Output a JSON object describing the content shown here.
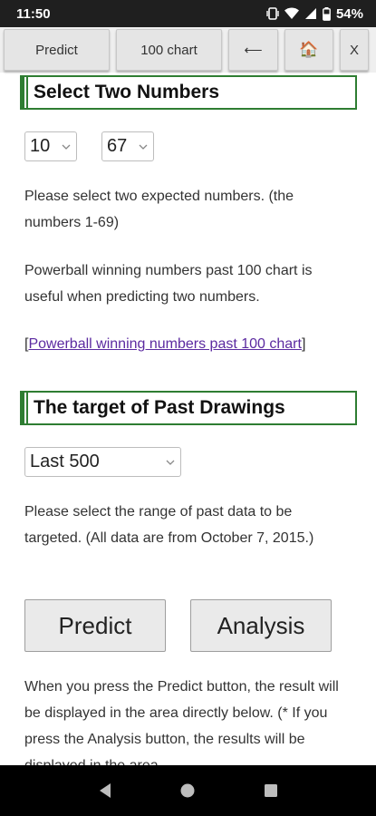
{
  "status_bar": {
    "time": "11:50",
    "battery": "54%"
  },
  "toolbar": {
    "predict_label": "Predict",
    "chart_label": "100 chart",
    "back_symbol": "⟵",
    "home_symbol": "🏠",
    "close_label": "X"
  },
  "select_numbers": {
    "heading": "Select Two Numbers",
    "first_value": "10",
    "second_value": "67",
    "help_text": "Please select two expected numbers. (the numbers 1-69)",
    "info_text": "Powerball winning numbers past 100 chart is useful when predicting two numbers.",
    "link_open": "[",
    "link_text": "Powerball winning numbers past 100 chart",
    "link_close": "]"
  },
  "past_drawings": {
    "heading": "The target of Past Drawings",
    "range_value": "Last 500",
    "help_text": "Please select the range of past data to be targeted. (All data are from October 7, 2015.)"
  },
  "actions": {
    "predict_label": "Predict",
    "analysis_label": "Analysis"
  },
  "footer_text": "When you press the Predict button, the result will be displayed in the area directly below. (* If you press the Analysis button, the results will be displayed in the area"
}
